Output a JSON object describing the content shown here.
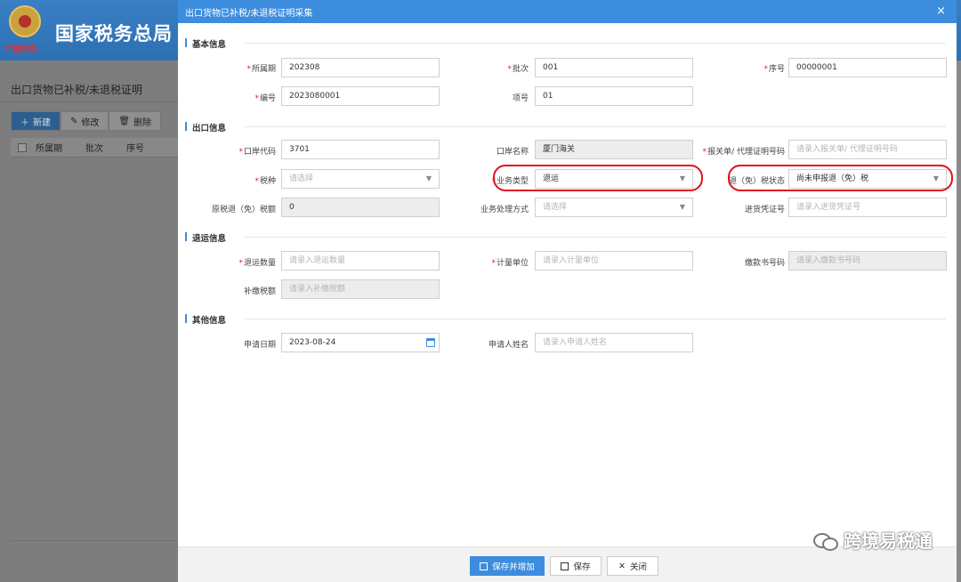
{
  "background": {
    "org_title": "国家税务总局",
    "emblem_text": "中国税务",
    "page_title": "出口货物已补税/未退税证明",
    "toolbar": {
      "new": "新建",
      "edit": "修改",
      "delete": "删除"
    },
    "table_headers": [
      "所属期",
      "批次",
      "序号"
    ]
  },
  "dialog": {
    "title": "出口货物已补税/未退税证明采集",
    "close": "×",
    "sections": {
      "basic": "基本信息",
      "export": "出口信息",
      "return": "退运信息",
      "other": "其他信息"
    },
    "fields": {
      "period": {
        "label": "所属期",
        "value": "202308"
      },
      "batch": {
        "label": "批次",
        "value": "001"
      },
      "seq": {
        "label": "序号",
        "value": "00000001"
      },
      "code": {
        "label": "编号",
        "value": "2023080001"
      },
      "item_no": {
        "label": "项号",
        "value": "01"
      },
      "port_code": {
        "label": "口岸代码",
        "value": "3701"
      },
      "port_name": {
        "label": "口岸名称",
        "value": "厦门海关"
      },
      "customs_no": {
        "label": "报关单/ 代理证明号码",
        "placeholder": "请录入报关单/ 代理证明号码"
      },
      "tax_type": {
        "label": "税种",
        "placeholder": "请选择"
      },
      "biz_type": {
        "label": "业务类型",
        "value": "退运"
      },
      "refund_status": {
        "label": "退（免）税状态",
        "value": "尚未申报退（免）税"
      },
      "orig_refund": {
        "label": "原税退（免）税额",
        "value": "0"
      },
      "handling": {
        "label": "业务处理方式",
        "placeholder": "请选择"
      },
      "invoice_no": {
        "label": "进货凭证号",
        "placeholder": "请录入进货凭证号"
      },
      "return_qty": {
        "label": "退运数量",
        "placeholder": "请录入退运数量"
      },
      "unit": {
        "label": "计量单位",
        "placeholder": "请录入计量单位"
      },
      "payment_no": {
        "label": "缴款书号码",
        "placeholder": "请录入缴款书号码"
      },
      "tax_paid": {
        "label": "补缴税额",
        "placeholder": "请录入补缴税额"
      },
      "apply_date": {
        "label": "申请日期",
        "value": "2023-08-24"
      },
      "applicant": {
        "label": "申请人姓名",
        "placeholder": "请录入申请人姓名"
      }
    },
    "buttons": {
      "save_add": "保存并增加",
      "save": "保存",
      "close": "关闭"
    }
  },
  "watermark": "跨境易税通",
  "colors": {
    "accent": "#3c8dde",
    "highlight": "#e0101e",
    "required": "#e02020"
  }
}
